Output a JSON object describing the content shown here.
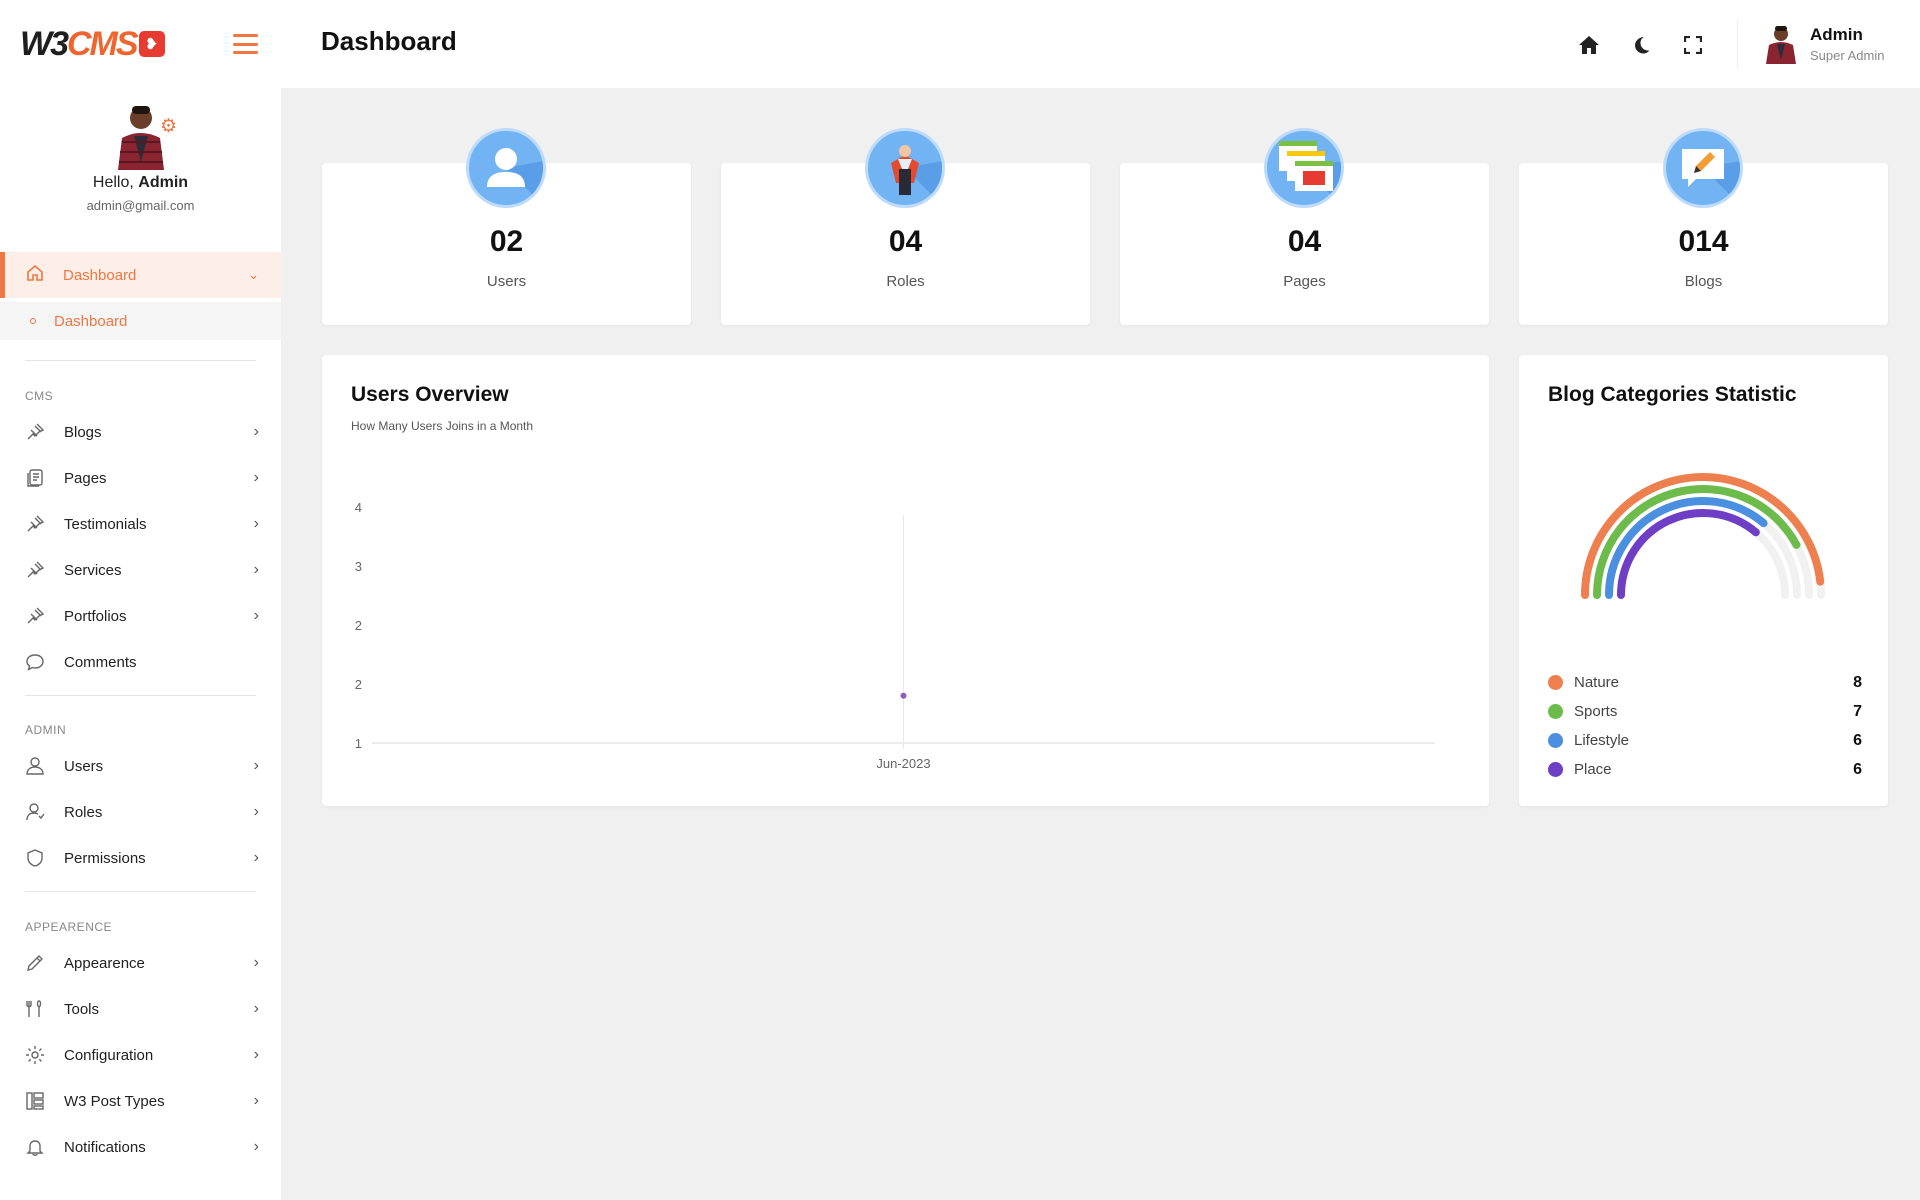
{
  "brand": {
    "logo_w3": "W3",
    "logo_cms": "CMS"
  },
  "profile": {
    "greeting": "Hello,",
    "name": "Admin",
    "email": "admin@gmail.com"
  },
  "sidebar": {
    "active": {
      "label": "Dashboard",
      "icon": "home-icon"
    },
    "sub_item": {
      "label": "Dashboard"
    },
    "sections": [
      {
        "title": "CMS",
        "items": [
          {
            "label": "Blogs",
            "icon": "pin-icon",
            "arrow": true
          },
          {
            "label": "Pages",
            "icon": "pages-icon",
            "arrow": true
          },
          {
            "label": "Testimonials",
            "icon": "pin-icon",
            "arrow": true
          },
          {
            "label": "Services",
            "icon": "pin-icon",
            "arrow": true
          },
          {
            "label": "Portfolios",
            "icon": "pin-icon",
            "arrow": true
          },
          {
            "label": "Comments",
            "icon": "comment-icon",
            "arrow": false
          }
        ]
      },
      {
        "title": "ADMIN",
        "items": [
          {
            "label": "Users",
            "icon": "user-icon",
            "arrow": true
          },
          {
            "label": "Roles",
            "icon": "role-icon",
            "arrow": true
          },
          {
            "label": "Permissions",
            "icon": "shield-icon",
            "arrow": true
          }
        ]
      },
      {
        "title": "APPEARENCE",
        "items": [
          {
            "label": "Appearence",
            "icon": "pencil-icon",
            "arrow": true
          },
          {
            "label": "Tools",
            "icon": "tools-icon",
            "arrow": true
          },
          {
            "label": "Configuration",
            "icon": "gear-icon",
            "arrow": true
          },
          {
            "label": "W3 Post Types",
            "icon": "layout-icon",
            "arrow": true
          },
          {
            "label": "Notifications",
            "icon": "bell-icon",
            "arrow": true
          }
        ]
      }
    ]
  },
  "header": {
    "title": "Dashboard",
    "user_name": "Admin",
    "user_role": "Super Admin"
  },
  "stats": [
    {
      "value": "02",
      "label": "Users",
      "icon": "user-avatar-icon"
    },
    {
      "value": "04",
      "label": "Roles",
      "icon": "role-figure-icon"
    },
    {
      "value": "04",
      "label": "Pages",
      "icon": "pages-stack-icon"
    },
    {
      "value": "014",
      "label": "Blogs",
      "icon": "blog-chat-icon"
    }
  ],
  "users_overview": {
    "title": "Users Overview",
    "subtitle": "How Many Users Joins in a Month"
  },
  "categories": {
    "title": "Blog Categories Statistic",
    "items": [
      {
        "name": "Nature",
        "value": "8",
        "color": "#ee8050"
      },
      {
        "name": "Sports",
        "value": "7",
        "color": "#6cbb4b"
      },
      {
        "name": "Lifestyle",
        "value": "6",
        "color": "#4a8fe0"
      },
      {
        "name": "Place",
        "value": "6",
        "color": "#6e3fc4"
      }
    ]
  },
  "chart_data": [
    {
      "type": "line",
      "title": "Users Overview",
      "subtitle": "How Many Users Joins in a Month",
      "x": [
        "Jun-2023"
      ],
      "series": [
        {
          "values": [
            1.6
          ]
        }
      ],
      "y_tick_labels": [
        "1",
        "2",
        "2",
        "3",
        "4"
      ],
      "ylim": [
        1,
        4
      ],
      "grid": false,
      "point_color": "#8e5bb5"
    },
    {
      "type": "radial-bar",
      "title": "Blog Categories Statistic",
      "categories": [
        "Nature",
        "Sports",
        "Lifestyle",
        "Place"
      ],
      "values": [
        8,
        7,
        6,
        6
      ],
      "colors": [
        "#ee8050",
        "#6cbb4b",
        "#4a8fe0",
        "#6e3fc4"
      ],
      "legend": "bottom"
    }
  ]
}
